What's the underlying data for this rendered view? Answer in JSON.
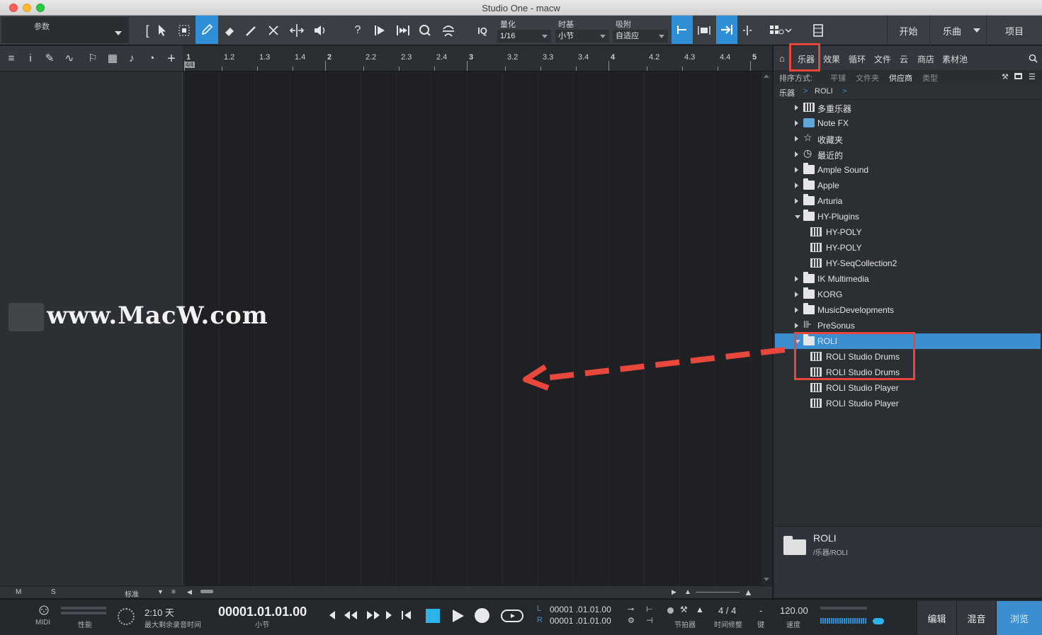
{
  "window": {
    "title": "Studio One - macw"
  },
  "toolbar": {
    "params_label": "参数",
    "quantize_label": "量化",
    "quantize_value": "1/16",
    "timebase_label": "时基",
    "timebase_value": "小节",
    "snap_label": "吸附",
    "snap_value": "自适应",
    "iq_label": "IQ",
    "start_label": "开始",
    "song_label": "乐曲",
    "project_label": "项目"
  },
  "ruler": {
    "ticks": [
      "1",
      "1.2",
      "1.3",
      "1.4",
      "2",
      "2.2",
      "2.3",
      "2.4",
      "3",
      "3.2",
      "3.3",
      "3.4",
      "4",
      "4.2",
      "4.3",
      "4.4",
      "5"
    ],
    "signature": "4/4"
  },
  "watermark": {
    "text": "www.MacW.com"
  },
  "left_footer": {
    "m": "M",
    "s": "S",
    "mode": "标准"
  },
  "browser": {
    "tabs": [
      "乐器",
      "效果",
      "循环",
      "文件",
      "云",
      "商店",
      "素材池"
    ],
    "sort_label": "排序方式:",
    "sort_options": [
      "平铺",
      "文件夹",
      "供应商",
      "类型"
    ],
    "breadcrumb": [
      "乐器",
      ">",
      "ROLI",
      ">"
    ],
    "tree": [
      {
        "label": "多重乐器",
        "icon": "multi-instrument-icon",
        "expand": "closed",
        "indent": 0
      },
      {
        "label": "Note FX",
        "icon": "notefx-icon",
        "expand": "closed",
        "indent": 0
      },
      {
        "label": "收藏夹",
        "icon": "star-icon",
        "expand": "closed",
        "indent": 0
      },
      {
        "label": "最近的",
        "icon": "clock-icon",
        "expand": "closed",
        "indent": 0
      },
      {
        "label": "Ample Sound",
        "icon": "folder-icon",
        "expand": "closed",
        "indent": 0
      },
      {
        "label": "Apple",
        "icon": "folder-icon",
        "expand": "closed",
        "indent": 0
      },
      {
        "label": "Arturia",
        "icon": "folder-icon",
        "expand": "closed",
        "indent": 0
      },
      {
        "label": "HY-Plugins",
        "icon": "folder-open-icon",
        "expand": "open",
        "indent": 0
      },
      {
        "label": "HY-POLY",
        "icon": "plugin-icon",
        "expand": "none",
        "indent": 1
      },
      {
        "label": "HY-POLY",
        "icon": "plugin-icon",
        "expand": "none",
        "indent": 1
      },
      {
        "label": "HY-SeqCollection2",
        "icon": "plugin-icon",
        "expand": "none",
        "indent": 1
      },
      {
        "label": "IK Multimedia",
        "icon": "folder-icon",
        "expand": "closed",
        "indent": 0
      },
      {
        "label": "KORG",
        "icon": "folder-icon",
        "expand": "closed",
        "indent": 0
      },
      {
        "label": "MusicDevelopments",
        "icon": "folder-icon",
        "expand": "closed",
        "indent": 0
      },
      {
        "label": "PreSonus",
        "icon": "presonus-icon",
        "expand": "closed",
        "indent": 0
      },
      {
        "label": "ROLI",
        "icon": "folder-open-icon",
        "expand": "open",
        "indent": 0,
        "selected": true
      },
      {
        "label": "ROLI Studio Drums",
        "icon": "plugin-icon",
        "expand": "none",
        "indent": 1
      },
      {
        "label": "ROLI Studio Drums",
        "icon": "plugin-icon",
        "expand": "none",
        "indent": 1
      },
      {
        "label": "ROLI Studio Player",
        "icon": "plugin-icon",
        "expand": "none",
        "indent": 1
      },
      {
        "label": "ROLI Studio Player",
        "icon": "plugin-icon",
        "expand": "none",
        "indent": 1
      }
    ],
    "info": {
      "name": "ROLI",
      "path": "/乐器/ROLI"
    }
  },
  "transport": {
    "midi_label": "MIDI",
    "perf_label": "性能",
    "record_time": "2:10 天",
    "record_time_label": "最大剩余录音时间",
    "position": "00001.01.01.00",
    "position_label": "小节",
    "loop_l_label": "L",
    "loop_l": "00001 .01.01.00",
    "loop_r_label": "R",
    "loop_r": "00001 .01.01.00",
    "metronome_label": "节拍器",
    "time_sig": "4 / 4",
    "time_sig_label": "时间修整",
    "key_value": "-",
    "key_label": "键",
    "tempo": "120.00",
    "tempo_label": "速度",
    "edit_label": "编辑",
    "mix_label": "混音",
    "browse_label": "浏览"
  },
  "colors": {
    "accent": "#3b8fd0",
    "annotation": "#e8473c"
  }
}
